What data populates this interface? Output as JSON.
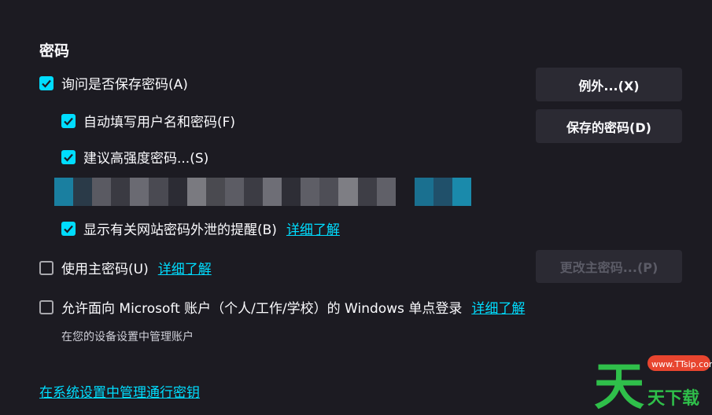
{
  "section_title": "密码",
  "options": {
    "ask_save": {
      "label": "询问是否保存密码(A)",
      "checked": true
    },
    "autofill": {
      "label": "自动填写用户名和密码(F)",
      "checked": true
    },
    "suggest_strong": {
      "label": "建议高强度密码...(S)",
      "checked": true
    },
    "breach_alerts": {
      "label": "显示有关网站密码外泄的提醒(B)",
      "checked": true,
      "link": "详细了解"
    },
    "primary_password": {
      "label": "使用主密码(U)",
      "checked": false,
      "link": "详细了解"
    },
    "windows_sso": {
      "label": "允许面向 Microsoft 账户（个人/工作/学校）的 Windows 单点登录",
      "checked": false,
      "link": "详细了解",
      "note": "在您的设备设置中管理账户"
    }
  },
  "buttons": {
    "exceptions": "例外...(X)",
    "saved_passwords": "保存的密码(D)",
    "change_primary": "更改主密码...(P)"
  },
  "system_link": "在系统设置中管理通行密钥",
  "watermark": {
    "site": "www.TTsip.com",
    "logo_text": "天下载"
  },
  "colors": {
    "background": "#1c1b22",
    "accent": "#00ddff",
    "button": "#2b2a33",
    "disabled_text": "#5b5b66"
  }
}
